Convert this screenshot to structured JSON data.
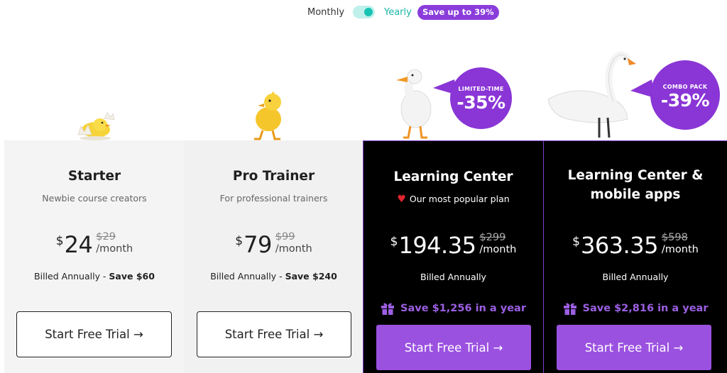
{
  "toggle": {
    "monthly_label": "Monthly",
    "yearly_label": "Yearly",
    "save_badge": "Save up to 39%",
    "selected": "Yearly"
  },
  "badges": {
    "learning_center": {
      "top": "LIMITED-TIME",
      "value": "-35%"
    },
    "combo": {
      "top": "COMBO PACK",
      "value": "-39%"
    }
  },
  "plans": [
    {
      "title": "Starter",
      "subtitle": "Newbie course creators",
      "currency": "$",
      "price": "24",
      "old_price": "$29",
      "period": "/month",
      "billed": "Billed Annually - ",
      "billed_save": "Save $60",
      "cta": "Start Free Trial →",
      "image": "hatching-chick"
    },
    {
      "title": "Pro Trainer",
      "subtitle": "For professional trainers",
      "currency": "$",
      "price": "79",
      "old_price": "$99",
      "period": "/month",
      "billed": "Billed Annually - ",
      "billed_save": "Save $240",
      "cta": "Start Free Trial →",
      "image": "duckling"
    },
    {
      "title": "Learning Center",
      "subtitle": "Our most popular plan",
      "currency": "$",
      "price": "194.35",
      "old_price": "$299",
      "period": "/month",
      "billed": "Billed Annually",
      "year_save": "Save $1,256 in a year",
      "cta": "Start Free Trial →",
      "image": "white-duck"
    },
    {
      "title": "Learning Center & mobile apps",
      "currency": "$",
      "price": "363.35",
      "old_price": "$598",
      "period": "/month",
      "billed": "Billed Annually",
      "year_save": "Save $2,816 in a year",
      "cta": "Start Free Trial →",
      "image": "swan"
    }
  ],
  "colors": {
    "accent": "#9b51e0",
    "badge": "#8a35d6",
    "toggle": "#18c3b3",
    "heart": "#e0262f"
  }
}
